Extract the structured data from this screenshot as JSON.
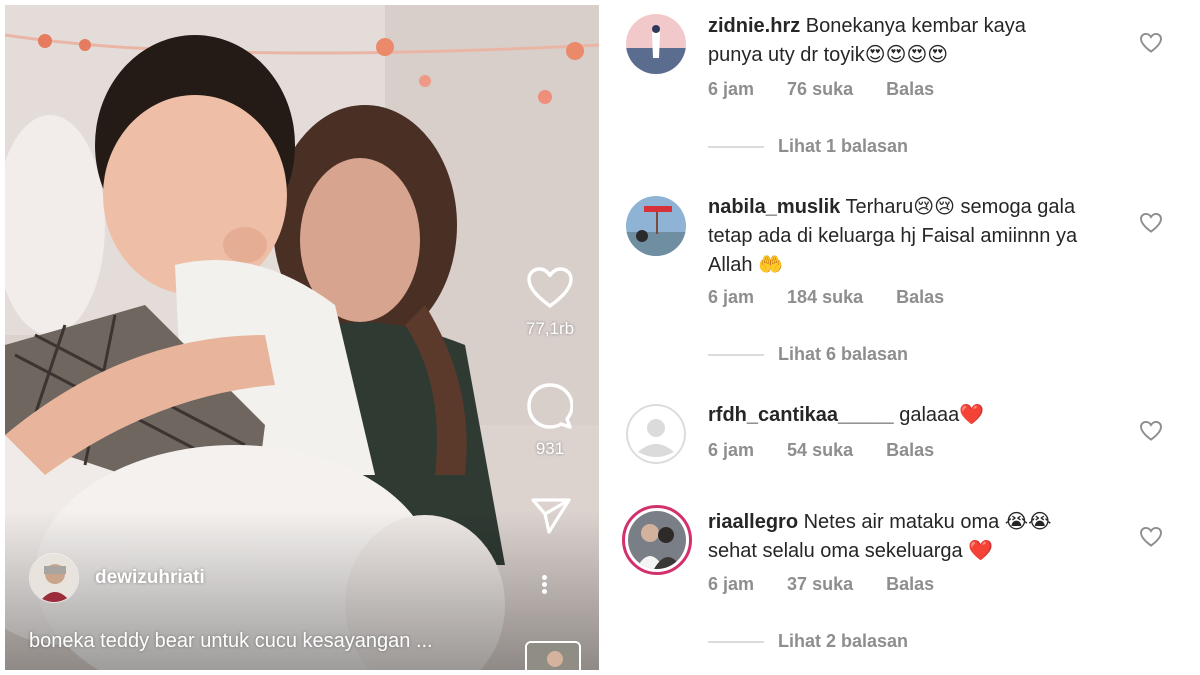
{
  "reel": {
    "author": "dewizuhriati",
    "caption": "boneka teddy bear untuk cucu kesayangan ...",
    "likes": "77,1rb",
    "comments_count": "931",
    "icons": {
      "like": "heart-icon",
      "comment": "comment-bubble-icon",
      "share": "paper-plane-icon",
      "more": "vertical-dots-icon"
    }
  },
  "comments": [
    {
      "user": "zidnie.hrz",
      "text": "Bonekanya kembar kaya punya uty dr toyik😍😍😍😍",
      "time": "6 jam",
      "likes": "76 suka",
      "reply": "Balas",
      "view_replies": "Lihat 1 balasan"
    },
    {
      "user": "nabila_muslik",
      "text": "Terharu😢😢 semoga gala tetap ada di keluarga hj Faisal amiinnn ya Allah 🤲",
      "time": "6 jam",
      "likes": "184 suka",
      "reply": "Balas",
      "view_replies": "Lihat 6 balasan"
    },
    {
      "user": "rfdh_cantikaa_____",
      "text": "galaaa❤️",
      "time": "6 jam",
      "likes": "54 suka",
      "reply": "Balas",
      "view_replies": ""
    },
    {
      "user": "riaallegro",
      "text": "Netes air mataku oma 😭😭 sehat selalu oma sekeluarga ❤️",
      "time": "6 jam",
      "likes": "37 suka",
      "reply": "Balas",
      "view_replies": "Lihat 2 balasan"
    }
  ],
  "colors": {
    "story_ring": "#d3306e",
    "meta_text": "#8e8e8e",
    "body_text": "#262626"
  }
}
